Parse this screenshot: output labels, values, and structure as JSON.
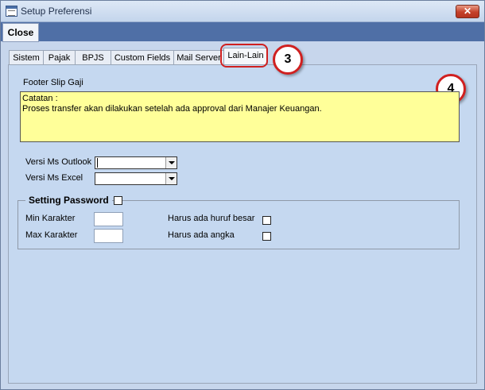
{
  "window": {
    "title": "Setup Preferensi"
  },
  "toolbar": {
    "close_label": "Close"
  },
  "tabs": [
    {
      "label": "Sistem"
    },
    {
      "label": "Pajak"
    },
    {
      "label": "BPJS"
    },
    {
      "label": "Custom Fields"
    },
    {
      "label": "Mail Server"
    },
    {
      "label": "Lain-Lain",
      "active": true
    }
  ],
  "callouts": {
    "tab": "3",
    "content": "4"
  },
  "footer": {
    "label": "Footer Slip Gaji",
    "line1": "Catatan :",
    "line2": "Proses transfer akan dilakukan setelah ada approval dari Manajer Keuangan."
  },
  "versions": {
    "outlook_label": "Versi Ms Outlook",
    "outlook_value": "",
    "excel_label": "Versi Ms Excel",
    "excel_value": ""
  },
  "password": {
    "title": "Setting Password",
    "enabled": false,
    "min_label": "Min Karakter",
    "min_value": "",
    "max_label": "Max Karakter",
    "max_value": "",
    "uppercase_label": "Harus ada huruf besar",
    "uppercase_checked": false,
    "digit_label": "Harus ada angka",
    "digit_checked": false
  },
  "colors": {
    "toolbar_bg": "#4f6fa6",
    "form_bg": "#c5d8f0",
    "footer_bg": "#ffff99",
    "callout_border": "#d02020"
  }
}
